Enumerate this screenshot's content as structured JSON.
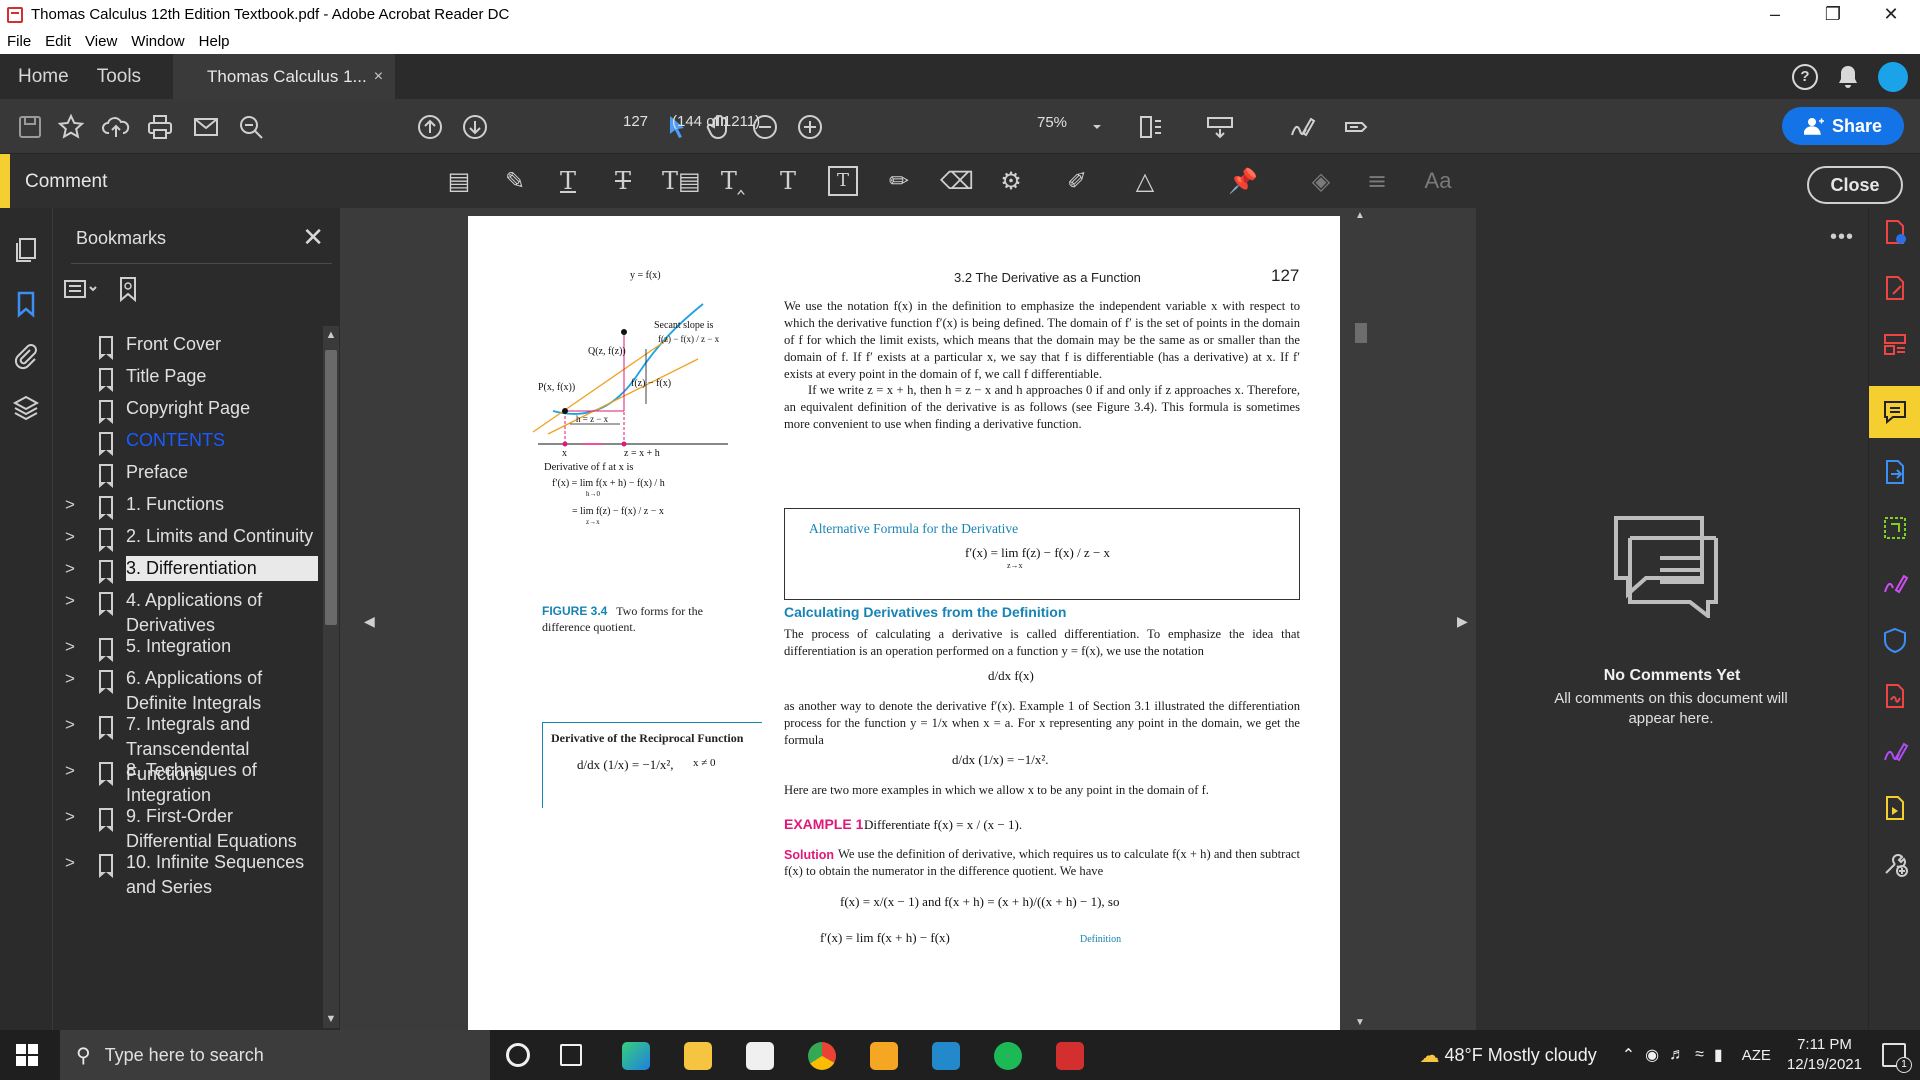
{
  "window": {
    "title": "Thomas Calculus 12th Edition Textbook.pdf - Adobe Acrobat Reader DC",
    "controls": [
      "–",
      "❐",
      "✕"
    ]
  },
  "menu": [
    "File",
    "Edit",
    "View",
    "Window",
    "Help"
  ],
  "tabs": {
    "home": "Home",
    "tools": "Tools",
    "document": "Thomas Calculus 1...",
    "close": "×"
  },
  "toolbar": {
    "page_number": "127",
    "page_total": "(144 of 1211)",
    "zoom": "75%",
    "share_label": "Share",
    "icons": [
      "save-icon",
      "star-icon",
      "upload-icon",
      "print-icon",
      "mail-icon",
      "zoom-search-icon",
      "page-up-icon",
      "page-down-icon",
      "select-cursor-icon",
      "hand-icon",
      "zoom-out-icon",
      "zoom-in-icon",
      "page-layout-icon",
      "keyboard-icon",
      "sign-icon",
      "fill-icon"
    ]
  },
  "comment_bar": {
    "label": "Comment",
    "close_label": "Close",
    "tools": [
      "sticky-note-icon",
      "highlight-icon",
      "underline-text-icon",
      "strikethrough-text-icon",
      "replace-text-icon",
      "insert-text-icon",
      "add-text-icon",
      "text-box-icon",
      "pencil-icon",
      "eraser-icon",
      "stamp-icon",
      "attach-icon",
      "shapes-icon",
      "pin-icon",
      "color-fill-icon",
      "line-style-icon",
      "font-icon"
    ]
  },
  "bookmarks": {
    "title": "Bookmarks",
    "items": [
      {
        "label": "Front Cover",
        "expandable": false
      },
      {
        "label": "Title Page",
        "expandable": false
      },
      {
        "label": "Copyright Page",
        "expandable": false
      },
      {
        "label": "CONTENTS",
        "expandable": false
      },
      {
        "label": "Preface",
        "expandable": false
      },
      {
        "label": "1. Functions",
        "expandable": true
      },
      {
        "label": "2. Limits and Continuity",
        "expandable": true
      },
      {
        "label": "3. Differentiation",
        "expandable": true
      },
      {
        "label": "4. Applications of Derivatives",
        "expandable": true
      },
      {
        "label": "5. Integration",
        "expandable": true
      },
      {
        "label": "6. Applications of Definite Integrals",
        "expandable": true
      },
      {
        "label": "7. Integrals and Transcendental Functions",
        "expandable": true
      },
      {
        "label": "8. Techniques of Integration",
        "expandable": true
      },
      {
        "label": "9. First-Order Differential Equations",
        "expandable": true
      },
      {
        "label": "10. Infinite Sequences and Series",
        "expandable": true
      }
    ]
  },
  "page": {
    "section_header": "3.2   The Derivative as a Function",
    "page_number": "127",
    "para1": "We use the notation f(x) in the definition to emphasize the independent variable x with respect to which the derivative function f′(x) is being defined. The domain of f′ is the set of points in the domain of f for which the limit exists, which means that the domain may be the same as or smaller than the domain of f. If f′ exists at a particular x, we say that f is differentiable (has a derivative) at x. If f′ exists at every point in the domain of f, we call f differentiable.",
    "para2": "If we write z = x + h, then h = z − x and h approaches 0 if and only if z approaches x. Therefore, an equivalent definition of the derivative is as follows (see Figure 3.4). This formula is sometimes more convenient to use when finding a derivative function.",
    "alt_formula_title": "Alternative Formula for the Derivative",
    "alt_formula": "f′(x) = lim  f(z) − f(x) / z − x",
    "alt_formula_lim": "z→x",
    "calc_heading": "Calculating Derivatives from the Definition",
    "para3": "The process of calculating a derivative is called differentiation. To emphasize the idea that differentiation is an operation performed on a function y = f(x), we use the notation",
    "notation": "d/dx f(x)",
    "para4": "as another way to denote the derivative f′(x). Example 1 of Section 3.1 illustrated the differentiation process for the function y = 1/x when x = a. For x representing any point in the domain, we get the formula",
    "recip_formula": "d/dx (1/x) = −1/x².",
    "para5": "Here are two more examples in which we allow x to be any point in the domain of f.",
    "example_label": "EXAMPLE 1",
    "example_text": "Differentiate f(x) = x / (x − 1).",
    "solution_label": "Solution",
    "solution_text": "We use the definition of derivative, which requires us to calculate f(x + h) and then subtract f(x) to obtain the numerator in the difference quotient. We have",
    "eq_line": "f(x) = x/(x − 1)   and   f(x + h) = (x + h)/((x + h) − 1), so",
    "eq_last": "f′(x) = lim  f(x + h) − f(x)",
    "eq_last_note": "Definition",
    "figure": {
      "label_y": "y = f(x)",
      "label_secant": "Secant slope is",
      "label_secant_frac": "f(z) − f(x) / z − x",
      "label_Q": "Q(z, f(z))",
      "label_P": "P(x, f(x))",
      "label_fz": "f(z) − f(x)",
      "label_h": "h = z − x",
      "label_x": "x",
      "label_z": "z = x + h",
      "deriv_line1": "Derivative of f at x is",
      "deriv_line2": "f′(x) = lim  f(x + h) − f(x) / h",
      "deriv_line2_sub": "h→0",
      "deriv_line3": "= lim  f(z) − f(x) / z − x",
      "deriv_line3_sub": "z→x",
      "caption_label": "FIGURE 3.4",
      "caption_text": "Two forms for the difference quotient."
    },
    "recip_box": {
      "title": "Derivative of the Reciprocal Function",
      "formula": "d/dx (1/x) = −1/x²,",
      "condition": "x ≠ 0"
    }
  },
  "comments_panel": {
    "title": "No Comments Yet",
    "body": "All comments on this document will appear here."
  },
  "taskbar": {
    "search_placeholder": "Type here to search",
    "weather": "48°F  Mostly cloudy",
    "language": "AZE",
    "time": "7:11 PM",
    "date": "12/19/2021",
    "notification_count": "1"
  },
  "colors": {
    "accent_yellow": "#f5cf2f",
    "share_blue": "#1473e6",
    "doc_cyan": "#1784b5",
    "example_magenta": "#e0187a"
  }
}
